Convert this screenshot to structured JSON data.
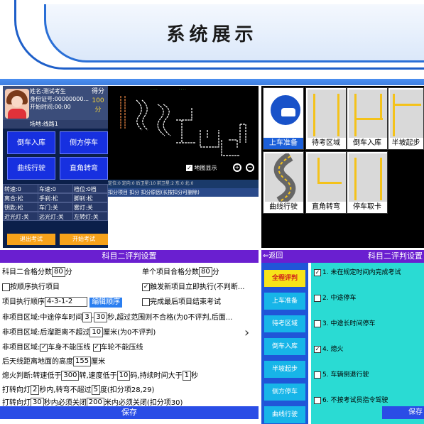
{
  "banner": {
    "title": "系统展示"
  },
  "exam": {
    "name": "姓名:测试考生",
    "id": "身份证号:00000000...",
    "start": "开始时间:00:00",
    "place": "场地:线路1",
    "score_label": "得分",
    "score_value": "100",
    "score_unit": "分",
    "buttons": [
      "倒车入库",
      "侧方停车",
      "曲线行驶",
      "直角转弯"
    ],
    "status": [
      "转速:0",
      "车速:0",
      "档位:0档",
      "安全带:松",
      "离合:松",
      "手刹:松",
      "脚刹:松",
      "安全带:松",
      "钥匙:松",
      "车门:关",
      "雾灯:关",
      "示宽灯:关",
      "近光灯:关",
      "远光灯:关",
      "左转灯:关",
      "右转灯:关",
      "挂灯:关",
      "前雾灯:关"
    ],
    "exit": "退出考试",
    "begin": "开始考试",
    "map_check": "地图显示",
    "stat_line": "定位:0   定向:0   后卫星:10  前卫星:2  东:0  北:0",
    "deduct_hdr": "扣分项目    扣分    扣分原因(长按扣分可删除)"
  },
  "tiles": [
    "上车准备",
    "待考区域",
    "倒车入库",
    "半坡起步",
    "曲线行驶",
    "直角转弯",
    "停车取卡"
  ],
  "settings2": {
    "title": "科目二评判设置",
    "r1a": "科目二合格分数",
    "r1a_val": "80",
    "r1a_unit": "分",
    "r1b": "单个项目合格分数",
    "r1b_val": "80",
    "r1b_unit": "分",
    "r2": "按顺序执行项目",
    "r2b": "触发新项目立即执行(不判断...",
    "r3": "项目执行顺序",
    "r3_val": "4-3-1-2",
    "r3_link": "编辑顺序",
    "r3b": "完成最后项目结束考试",
    "r4": "非项目区域:中途停车时间",
    "r4_v1": "3",
    "r4_v2": "30",
    "r4_tail": "秒,超过范围则不合格(为0不评判,后面...",
    "r5": "非项目区域:后溜距离不超过",
    "r5_v": "10",
    "r5_tail": "厘米(为0不评判)",
    "r6": "非项目区域:",
    "r6_a": "车身不能压线",
    "r6_b": "车轮不能压线",
    "r7": "后天线距离地面的高度",
    "r7_v": "155",
    "r7_unit": "厘米",
    "r8": "熄火判断:转速低于",
    "r8_v1": "300",
    "r8_m": "转,速度低于",
    "r8_v2": "10",
    "r8_m2": "码,持续时间大于",
    "r8_v3": "1",
    "r8_unit": "秒",
    "r9": "打转向灯",
    "r9_v1": "2",
    "r9_m": "秒内,转弯不超过",
    "r9_v2": "5",
    "r9_tail": "度(扣分项28,29)",
    "r10": "打转向灯",
    "r10_v1": "30",
    "r10_m": "秒内必须关闭",
    "r10_v2": "200",
    "r10_tail": "米内必须关闭(扣分项30)",
    "save": "保存"
  },
  "settings3": {
    "back": "返回",
    "title": "科目二评判设置",
    "tabs": [
      "全程评判",
      "上车准备",
      "待考区域",
      "倒车入库",
      "半坡起步",
      "侧方停车",
      "曲线行驶"
    ],
    "items": [
      "1. 未在规定时间内完成考试",
      "2. 中途停车",
      "3. 中途长时间停车",
      "4. 熄火",
      "5. 车辆倒退行驶",
      "6. 不按考试员指令驾驶"
    ],
    "save": "保存"
  }
}
